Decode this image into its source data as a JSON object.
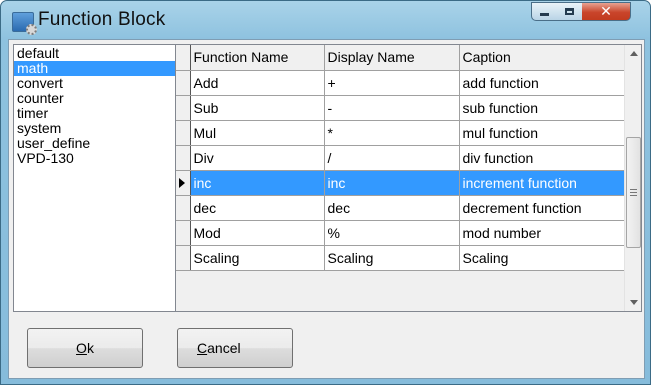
{
  "window": {
    "title": "Function Block",
    "controls": {
      "minimize_icon": "minimize-icon",
      "maximize_icon": "maximize-icon",
      "close_icon": "close-icon"
    }
  },
  "categories": {
    "items": [
      "default",
      "math",
      "convert",
      "counter",
      "timer",
      "system",
      "user_define",
      "VPD-130"
    ],
    "selected": "math"
  },
  "grid": {
    "headers": [
      "Function Name",
      "Display Name",
      "Caption"
    ],
    "rows": [
      {
        "function_name": "Add",
        "display_name": "+",
        "caption": "add function"
      },
      {
        "function_name": "Sub",
        "display_name": "-",
        "caption": "sub function"
      },
      {
        "function_name": "Mul",
        "display_name": "*",
        "caption": "mul function"
      },
      {
        "function_name": "Div",
        "display_name": "/",
        "caption": "div function"
      },
      {
        "function_name": "inc",
        "display_name": "inc",
        "caption": "increment function"
      },
      {
        "function_name": "dec",
        "display_name": "dec",
        "caption": "decrement function"
      },
      {
        "function_name": "Mod",
        "display_name": "%",
        "caption": "mod number"
      },
      {
        "function_name": "Scaling",
        "display_name": "Scaling",
        "caption": "Scaling"
      }
    ],
    "selected_row_label": "inc"
  },
  "buttons": {
    "ok_label": "Ok",
    "cancel_label": "Cancel"
  },
  "colors": {
    "selection": "#3399ff",
    "titlebar": "#a9d3e9",
    "close_button": "#c9452b"
  }
}
